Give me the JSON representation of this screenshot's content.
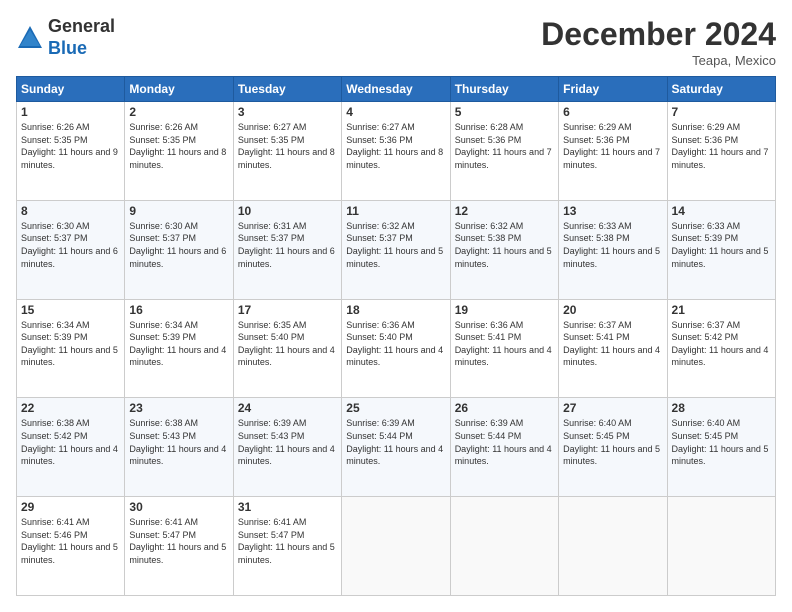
{
  "header": {
    "logo_line1": "General",
    "logo_line2": "Blue",
    "month_title": "December 2024",
    "location": "Teapa, Mexico"
  },
  "days_of_week": [
    "Sunday",
    "Monday",
    "Tuesday",
    "Wednesday",
    "Thursday",
    "Friday",
    "Saturday"
  ],
  "weeks": [
    [
      {
        "day": 1,
        "sunrise": "6:26 AM",
        "sunset": "5:35 PM",
        "daylight": "11 hours and 9 minutes."
      },
      {
        "day": 2,
        "sunrise": "6:26 AM",
        "sunset": "5:35 PM",
        "daylight": "11 hours and 8 minutes."
      },
      {
        "day": 3,
        "sunrise": "6:27 AM",
        "sunset": "5:35 PM",
        "daylight": "11 hours and 8 minutes."
      },
      {
        "day": 4,
        "sunrise": "6:27 AM",
        "sunset": "5:36 PM",
        "daylight": "11 hours and 8 minutes."
      },
      {
        "day": 5,
        "sunrise": "6:28 AM",
        "sunset": "5:36 PM",
        "daylight": "11 hours and 7 minutes."
      },
      {
        "day": 6,
        "sunrise": "6:29 AM",
        "sunset": "5:36 PM",
        "daylight": "11 hours and 7 minutes."
      },
      {
        "day": 7,
        "sunrise": "6:29 AM",
        "sunset": "5:36 PM",
        "daylight": "11 hours and 7 minutes."
      }
    ],
    [
      {
        "day": 8,
        "sunrise": "6:30 AM",
        "sunset": "5:37 PM",
        "daylight": "11 hours and 6 minutes."
      },
      {
        "day": 9,
        "sunrise": "6:30 AM",
        "sunset": "5:37 PM",
        "daylight": "11 hours and 6 minutes."
      },
      {
        "day": 10,
        "sunrise": "6:31 AM",
        "sunset": "5:37 PM",
        "daylight": "11 hours and 6 minutes."
      },
      {
        "day": 11,
        "sunrise": "6:32 AM",
        "sunset": "5:37 PM",
        "daylight": "11 hours and 5 minutes."
      },
      {
        "day": 12,
        "sunrise": "6:32 AM",
        "sunset": "5:38 PM",
        "daylight": "11 hours and 5 minutes."
      },
      {
        "day": 13,
        "sunrise": "6:33 AM",
        "sunset": "5:38 PM",
        "daylight": "11 hours and 5 minutes."
      },
      {
        "day": 14,
        "sunrise": "6:33 AM",
        "sunset": "5:39 PM",
        "daylight": "11 hours and 5 minutes."
      }
    ],
    [
      {
        "day": 15,
        "sunrise": "6:34 AM",
        "sunset": "5:39 PM",
        "daylight": "11 hours and 5 minutes."
      },
      {
        "day": 16,
        "sunrise": "6:34 AM",
        "sunset": "5:39 PM",
        "daylight": "11 hours and 4 minutes."
      },
      {
        "day": 17,
        "sunrise": "6:35 AM",
        "sunset": "5:40 PM",
        "daylight": "11 hours and 4 minutes."
      },
      {
        "day": 18,
        "sunrise": "6:36 AM",
        "sunset": "5:40 PM",
        "daylight": "11 hours and 4 minutes."
      },
      {
        "day": 19,
        "sunrise": "6:36 AM",
        "sunset": "5:41 PM",
        "daylight": "11 hours and 4 minutes."
      },
      {
        "day": 20,
        "sunrise": "6:37 AM",
        "sunset": "5:41 PM",
        "daylight": "11 hours and 4 minutes."
      },
      {
        "day": 21,
        "sunrise": "6:37 AM",
        "sunset": "5:42 PM",
        "daylight": "11 hours and 4 minutes."
      }
    ],
    [
      {
        "day": 22,
        "sunrise": "6:38 AM",
        "sunset": "5:42 PM",
        "daylight": "11 hours and 4 minutes."
      },
      {
        "day": 23,
        "sunrise": "6:38 AM",
        "sunset": "5:43 PM",
        "daylight": "11 hours and 4 minutes."
      },
      {
        "day": 24,
        "sunrise": "6:39 AM",
        "sunset": "5:43 PM",
        "daylight": "11 hours and 4 minutes."
      },
      {
        "day": 25,
        "sunrise": "6:39 AM",
        "sunset": "5:44 PM",
        "daylight": "11 hours and 4 minutes."
      },
      {
        "day": 26,
        "sunrise": "6:39 AM",
        "sunset": "5:44 PM",
        "daylight": "11 hours and 4 minutes."
      },
      {
        "day": 27,
        "sunrise": "6:40 AM",
        "sunset": "5:45 PM",
        "daylight": "11 hours and 5 minutes."
      },
      {
        "day": 28,
        "sunrise": "6:40 AM",
        "sunset": "5:45 PM",
        "daylight": "11 hours and 5 minutes."
      }
    ],
    [
      {
        "day": 29,
        "sunrise": "6:41 AM",
        "sunset": "5:46 PM",
        "daylight": "11 hours and 5 minutes."
      },
      {
        "day": 30,
        "sunrise": "6:41 AM",
        "sunset": "5:47 PM",
        "daylight": "11 hours and 5 minutes."
      },
      {
        "day": 31,
        "sunrise": "6:41 AM",
        "sunset": "5:47 PM",
        "daylight": "11 hours and 5 minutes."
      },
      null,
      null,
      null,
      null
    ]
  ],
  "labels": {
    "sunrise": "Sunrise:",
    "sunset": "Sunset:",
    "daylight": "Daylight:"
  }
}
